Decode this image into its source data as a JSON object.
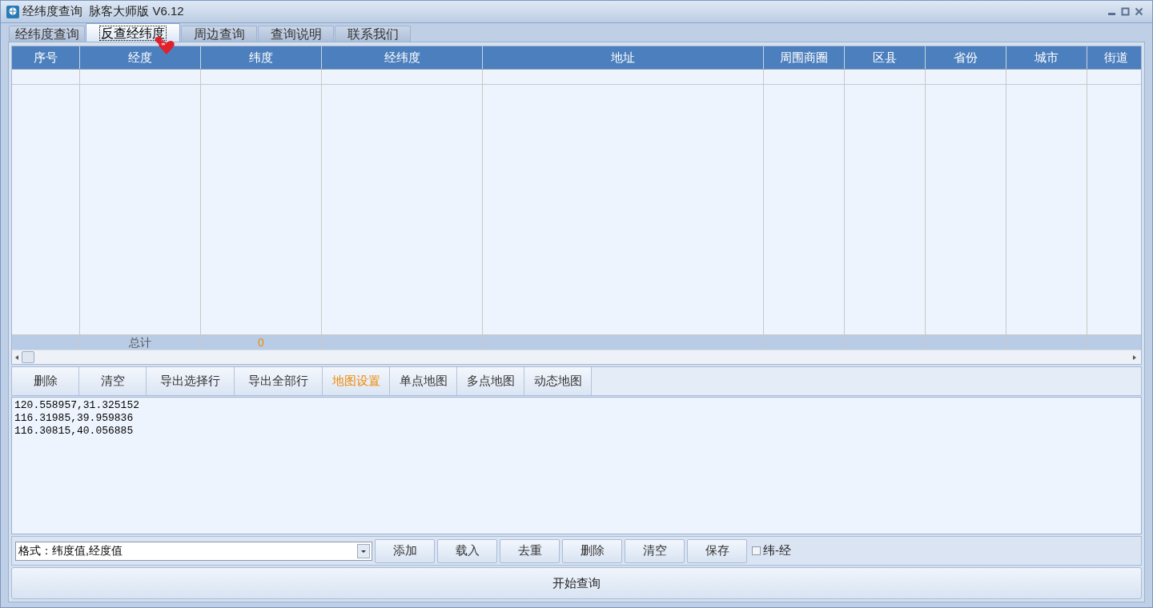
{
  "window": {
    "title": "经纬度查询  脉客大师版 V6.12"
  },
  "tabs": [
    {
      "label": "经纬度查询",
      "selected": false
    },
    {
      "label": "反查经纬度",
      "selected": true
    },
    {
      "label": "周边查询",
      "selected": false
    },
    {
      "label": "查询说明",
      "selected": false
    },
    {
      "label": "联系我们",
      "selected": false
    }
  ],
  "table": {
    "columns": [
      "序号",
      "经度",
      "纬度",
      "经纬度",
      "地址",
      "周围商圈",
      "区县",
      "省份",
      "城市",
      "街道"
    ],
    "total_row": {
      "label": "总计",
      "count": "0"
    }
  },
  "result_buttons": [
    {
      "label": "删除",
      "highlighted": false
    },
    {
      "label": "清空",
      "highlighted": false
    },
    {
      "label": "导出选择行",
      "highlighted": false
    },
    {
      "label": "导出全部行",
      "highlighted": false
    },
    {
      "label": "地图设置",
      "highlighted": true
    },
    {
      "label": "单点地图",
      "highlighted": false
    },
    {
      "label": "多点地图",
      "highlighted": false
    },
    {
      "label": "动态地图",
      "highlighted": false
    }
  ],
  "input_lines": [
    "120.558957,31.325152",
    "116.31985,39.959836",
    "116.30815,40.056885"
  ],
  "format_select": {
    "value": "格式：纬度值,经度值"
  },
  "input_buttons": [
    "添加",
    "载入",
    "去重",
    "删除",
    "清空",
    "保存"
  ],
  "swap_checkbox": {
    "label": "纬-经",
    "checked": false
  },
  "start_button": "开始查询"
}
